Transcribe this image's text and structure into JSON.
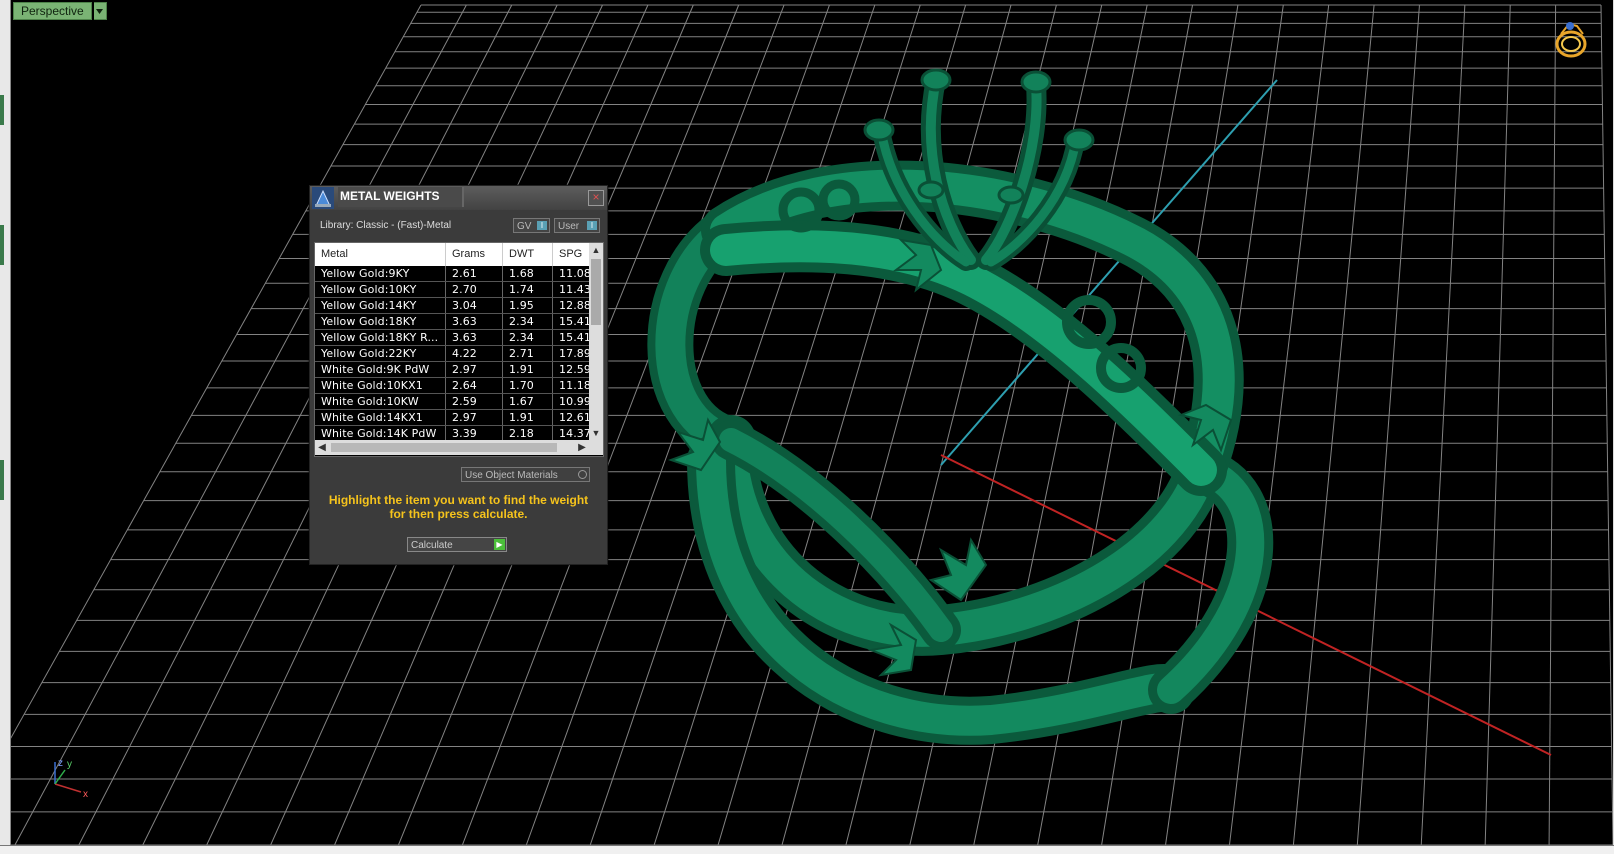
{
  "viewport": {
    "view_name": "Perspective",
    "background": "#000000",
    "grid_color": "#9a9a9a",
    "model_color": "#0e6a48",
    "axis_gizmo": {
      "x": "x",
      "y": "y",
      "z": "z"
    },
    "view_cube_icon": "ring-navigation-icon"
  },
  "dialog": {
    "title": "METAL WEIGHTS",
    "close_icon": "close-icon",
    "library_label": "Library: Classic - (Fast)-Metal",
    "toggle_gv": "GV",
    "toggle_user": "User",
    "table": {
      "columns": [
        "Metal",
        "Grams",
        "DWT",
        "SPG"
      ],
      "rows": [
        [
          "Yellow Gold:9KY",
          "2.61",
          "1.68",
          "11.08"
        ],
        [
          "Yellow Gold:10KY",
          "2.70",
          "1.74",
          "11.43"
        ],
        [
          "Yellow Gold:14KY",
          "3.04",
          "1.95",
          "12.88"
        ],
        [
          "Yellow Gold:18KY",
          "3.63",
          "2.34",
          "15.41"
        ],
        [
          "Yellow Gold:18KY R...",
          "3.63",
          "2.34",
          "15.41"
        ],
        [
          "Yellow Gold:22KY",
          "4.22",
          "2.71",
          "17.89"
        ],
        [
          "White Gold:9K PdW",
          "2.97",
          "1.91",
          "12.59"
        ],
        [
          "White Gold:10KX1",
          "2.64",
          "1.70",
          "11.18"
        ],
        [
          "White Gold:10KW",
          "2.59",
          "1.67",
          "10.99"
        ],
        [
          "White Gold:14KX1",
          "2.97",
          "1.91",
          "12.61"
        ],
        [
          "White Gold:14K PdW",
          "3.39",
          "2.18",
          "14.37"
        ]
      ]
    },
    "use_object_materials": "Use Object Materials",
    "instruction_line1": "Highlight the item you want to find the weight",
    "instruction_line2": "for then press calculate.",
    "calculate_label": "Calculate"
  }
}
